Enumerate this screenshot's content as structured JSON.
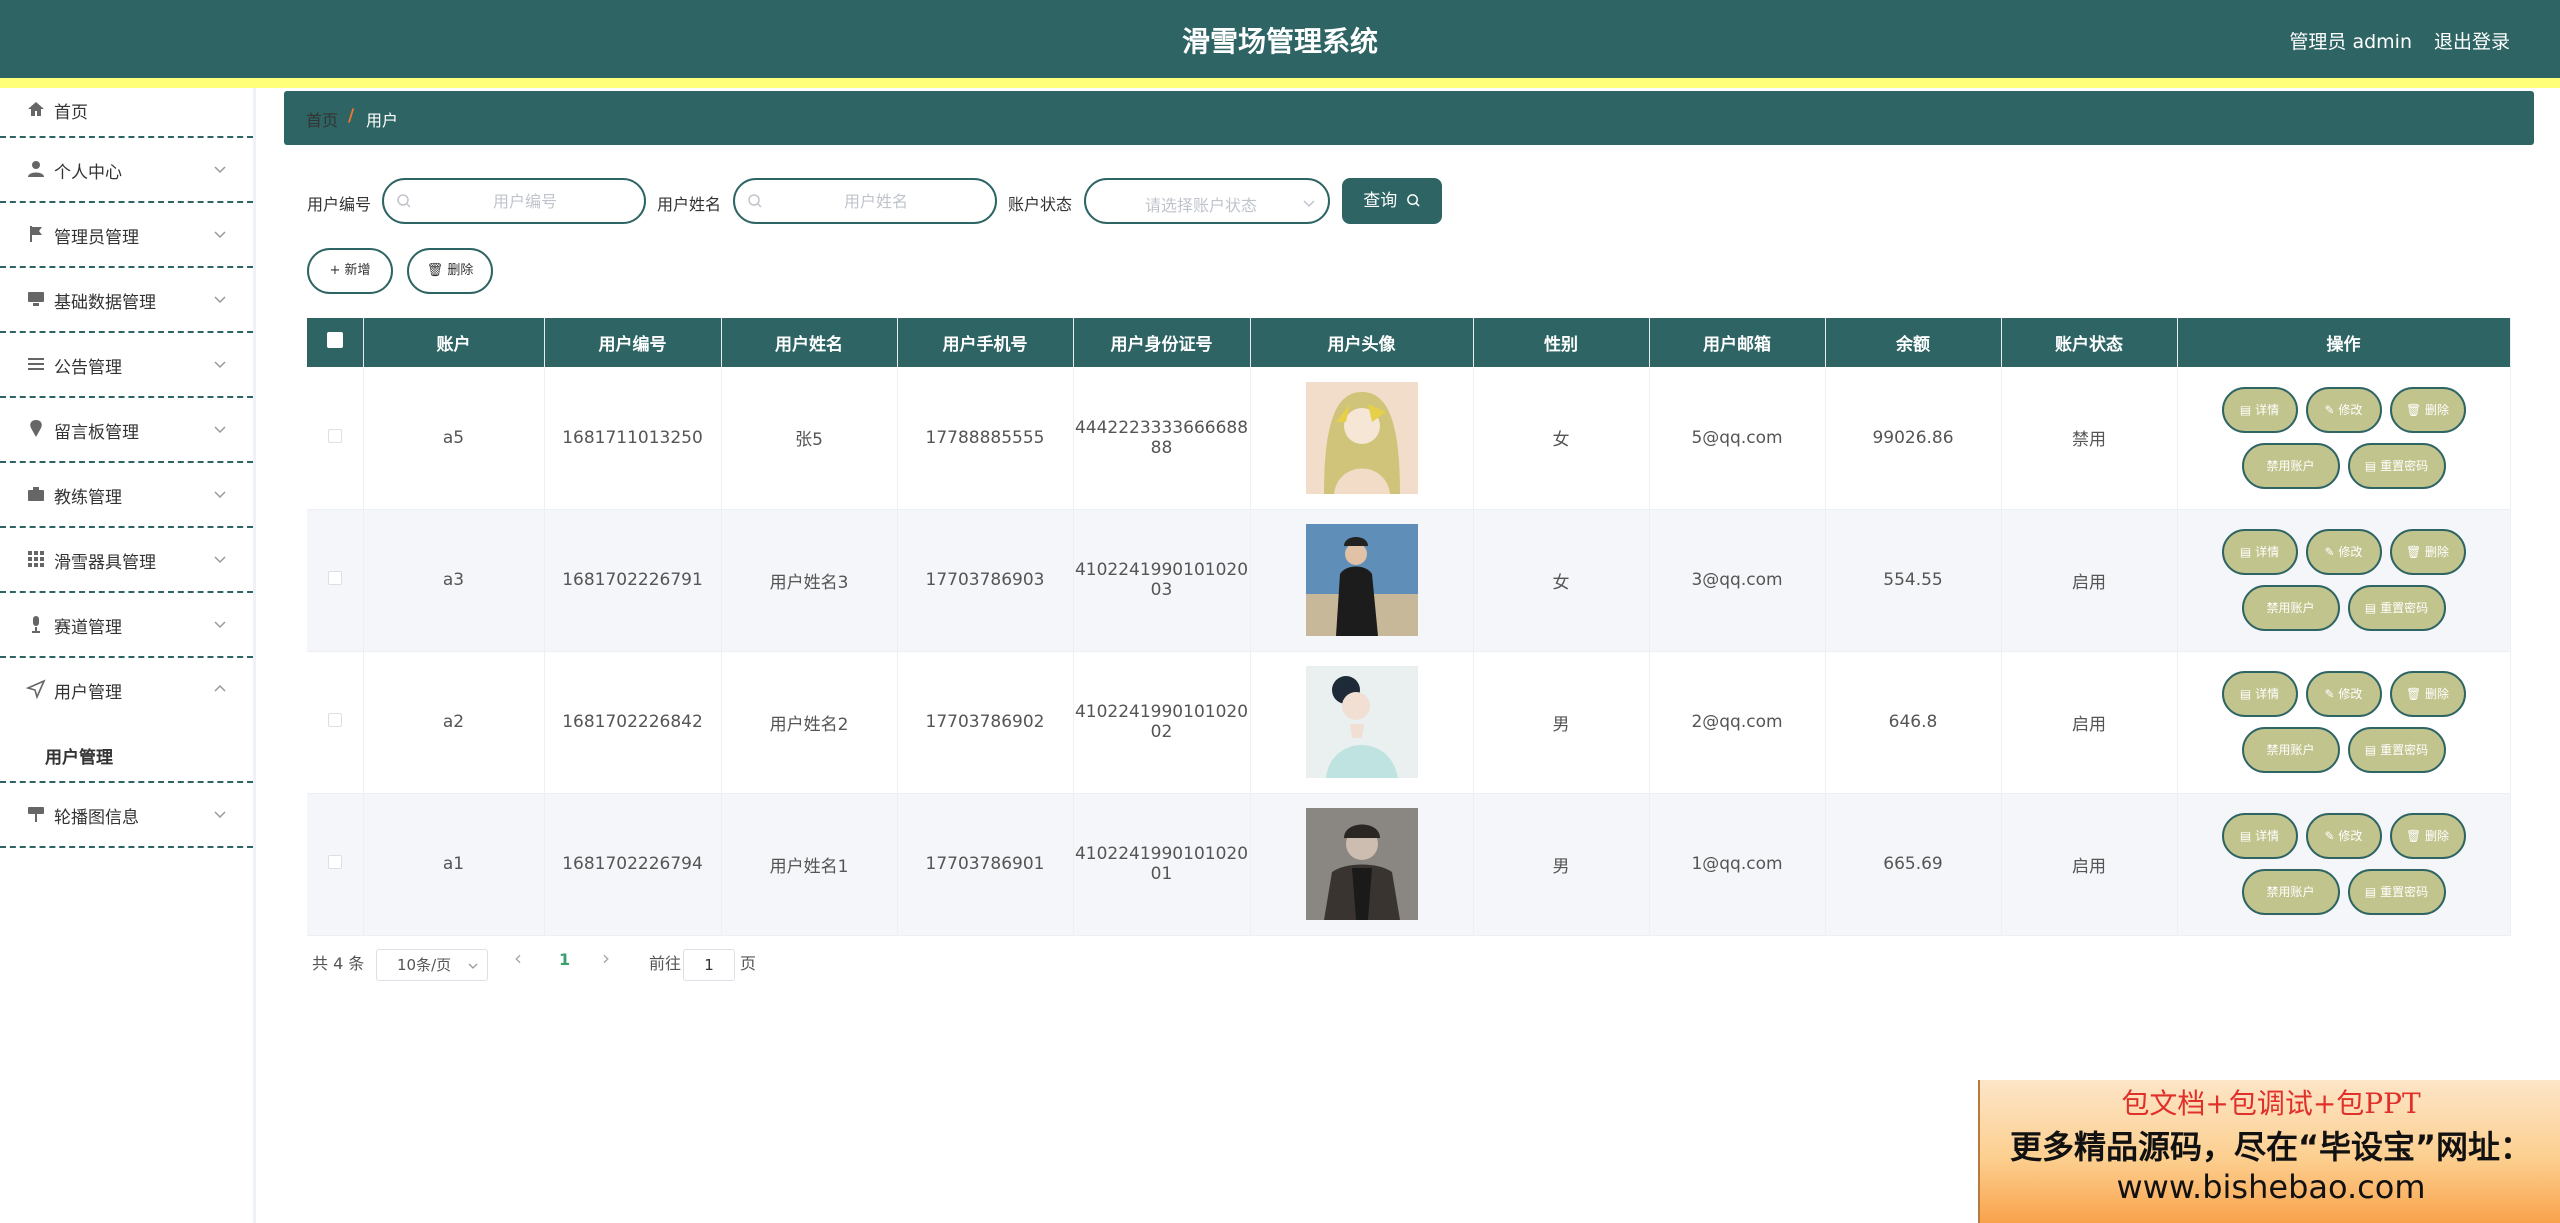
{
  "header": {
    "title": "滑雪场管理系统",
    "user": "管理员 admin",
    "logout": "退出登录"
  },
  "sidebar": {
    "items": [
      {
        "label": "首页",
        "icon": "home-icon"
      },
      {
        "label": "个人中心",
        "icon": "person-icon"
      },
      {
        "label": "管理员管理",
        "icon": "flag-icon"
      },
      {
        "label": "基础数据管理",
        "icon": "monitor-icon"
      },
      {
        "label": "公告管理",
        "icon": "list-icon"
      },
      {
        "label": "留言板管理",
        "icon": "pin-icon"
      },
      {
        "label": "教练管理",
        "icon": "briefcase-icon"
      },
      {
        "label": "滑雪器具管理",
        "icon": "grid-icon"
      },
      {
        "label": "赛道管理",
        "icon": "mic-icon"
      },
      {
        "label": "用户管理",
        "icon": "send-icon",
        "sub": "用户管理"
      },
      {
        "label": "轮播图信息",
        "icon": "signpost-icon"
      }
    ]
  },
  "breadcrumb": {
    "home": "首页",
    "sep": "/",
    "current": "用户"
  },
  "search": {
    "id_label": "用户编号",
    "id_placeholder": "用户编号",
    "name_label": "用户姓名",
    "name_placeholder": "用户姓名",
    "status_label": "账户状态",
    "status_placeholder": "请选择账户状态",
    "query": "查询"
  },
  "actions": {
    "add": "新增",
    "delete": "删除"
  },
  "table": {
    "headers": [
      "账户",
      "用户编号",
      "用户姓名",
      "用户手机号",
      "用户身份证号",
      "用户头像",
      "性别",
      "用户邮箱",
      "余额",
      "账户状态",
      "操作"
    ],
    "rows": [
      {
        "account": "a5",
        "id": "1681711013250",
        "name": "张5",
        "phone": "17788885555",
        "idcard_1": "4442223333666688",
        "idcard_2": "88",
        "gender": "女",
        "email": "5@qq.com",
        "balance": "99026.86",
        "status": "禁用"
      },
      {
        "account": "a3",
        "id": "1681702226791",
        "name": "用户姓名3",
        "phone": "17703786903",
        "idcard_1": "4102241990101020",
        "idcard_2": "03",
        "gender": "女",
        "email": "3@qq.com",
        "balance": "554.55",
        "status": "启用"
      },
      {
        "account": "a2",
        "id": "1681702226842",
        "name": "用户姓名2",
        "phone": "17703786902",
        "idcard_1": "4102241990101020",
        "idcard_2": "02",
        "gender": "男",
        "email": "2@qq.com",
        "balance": "646.8",
        "status": "启用"
      },
      {
        "account": "a1",
        "id": "1681702226794",
        "name": "用户姓名1",
        "phone": "17703786901",
        "idcard_1": "4102241990101020",
        "idcard_2": "01",
        "gender": "男",
        "email": "1@qq.com",
        "balance": "665.69",
        "status": "启用"
      }
    ],
    "ops": {
      "detail": "详情",
      "edit": "修改",
      "delete": "删除",
      "disable": "禁用账户",
      "reset": "重置密码"
    }
  },
  "pagination": {
    "total": "共 4 条",
    "page_size": "10条/页",
    "prev": "‹",
    "current": "1",
    "next": "›",
    "goto": "前往",
    "goto_value": "1",
    "page_unit": "页"
  },
  "ad": {
    "line1": "包文档+包调试+包PPT",
    "line2": "更多精品源码，尽在“毕设宝”网址：",
    "line3": "www.bishebao.com"
  },
  "colors": {
    "primary": "#2e6464",
    "accent_bar": "#ffff7a",
    "op_button": "#c2c48e",
    "crumb_sep": "#f0772c",
    "active_page": "#3aa06e"
  }
}
